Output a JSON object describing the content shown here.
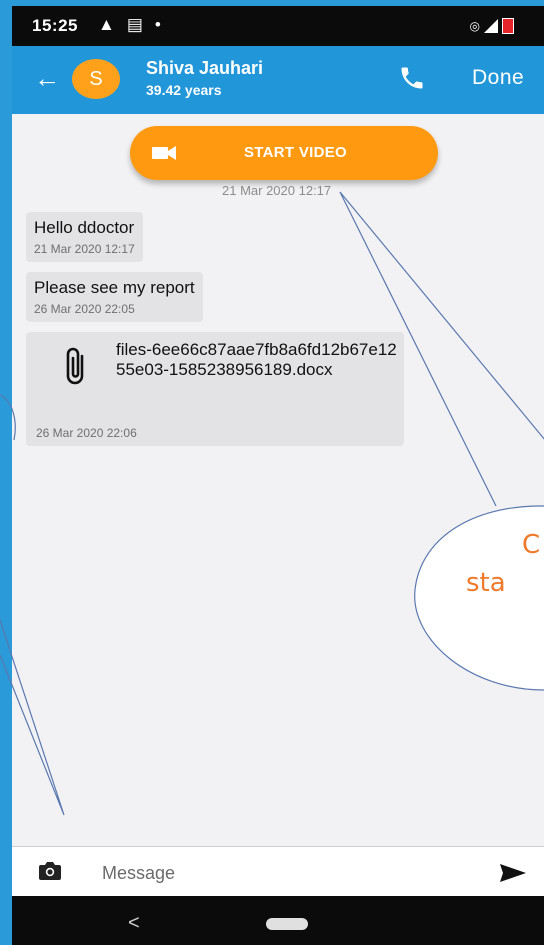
{
  "status_bar": {
    "time": "15:25",
    "left_icons": [
      "warning-icon",
      "message-icon",
      "dot-icon"
    ],
    "right_icons": [
      "hotspot-icon",
      "signal-icon",
      "battery-icon"
    ]
  },
  "header": {
    "avatar_letter": "S",
    "name": "Shiva Jauhari",
    "age": "39.42 years",
    "done_label": "Done",
    "avatar_color": "#ffa11a",
    "bar_color": "#2196d8"
  },
  "chat": {
    "video_button_label": "START VIDEO",
    "video_button_color": "#ff9a10",
    "video_timestamp": "21 Mar 2020 12:17",
    "messages": [
      {
        "text": "Hello ddoctor",
        "timestamp": "21 Mar 2020 12:17"
      },
      {
        "text": "Please see my report",
        "timestamp": "26 Mar 2020 22:05"
      }
    ],
    "file_message": {
      "file_name": "files-6ee66c87aae7fb8a6fd12b67e1255e03-1585238956189.docx",
      "timestamp": "26 Mar 2020 22:06"
    }
  },
  "annotation": {
    "callout_text_line1": "C",
    "callout_text_line2": "sta",
    "color": "#ee7a2c"
  },
  "input": {
    "placeholder": "Message"
  }
}
